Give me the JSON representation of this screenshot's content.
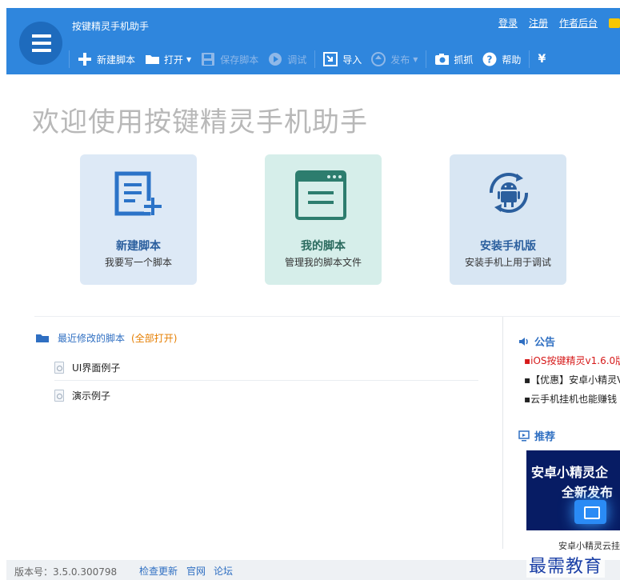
{
  "app": {
    "title": "按键精灵手机助手"
  },
  "top_links": {
    "login": "登录",
    "register": "注册",
    "author": "作者后台"
  },
  "toolbar": {
    "new_script": "新建脚本",
    "open": "打开",
    "save": "保存脚本",
    "debug": "调试",
    "import": "导入",
    "publish": "发布",
    "capture": "抓抓",
    "help": "帮助",
    "yen": "¥"
  },
  "welcome": "欢迎使用按键精灵手机助手",
  "cards": [
    {
      "title": "新建脚本",
      "subtitle": "我要写一个脚本"
    },
    {
      "title": "我的脚本",
      "subtitle": "管理我的脚本文件"
    },
    {
      "title": "安装手机版",
      "subtitle": "安装手机上用于调试"
    }
  ],
  "recent": {
    "label": "最近修改的脚本",
    "open_all": "(全部打开)",
    "files": [
      "UI界面例子",
      "演示例子"
    ]
  },
  "announce": {
    "title": "公告",
    "items": [
      "▪iOS按键精灵v1.6.0版",
      "▪【优惠】安卓小精灵V",
      "▪云手机挂机也能赚钱"
    ]
  },
  "recommend": {
    "title": "推荐",
    "promo_line1": "安卓小精灵企",
    "promo_line2": "全新发布",
    "caption": "安卓小精灵云挂"
  },
  "footer": {
    "version": "版本号：3.5.0.300798",
    "check_update": "检查更新",
    "official": "官网",
    "forum": "论坛"
  },
  "watermark": "最需教育",
  "colors": {
    "header": "#2f86dd",
    "accent": "#2f6fc2",
    "orange": "#e67e00",
    "red": "#d61a1a"
  }
}
